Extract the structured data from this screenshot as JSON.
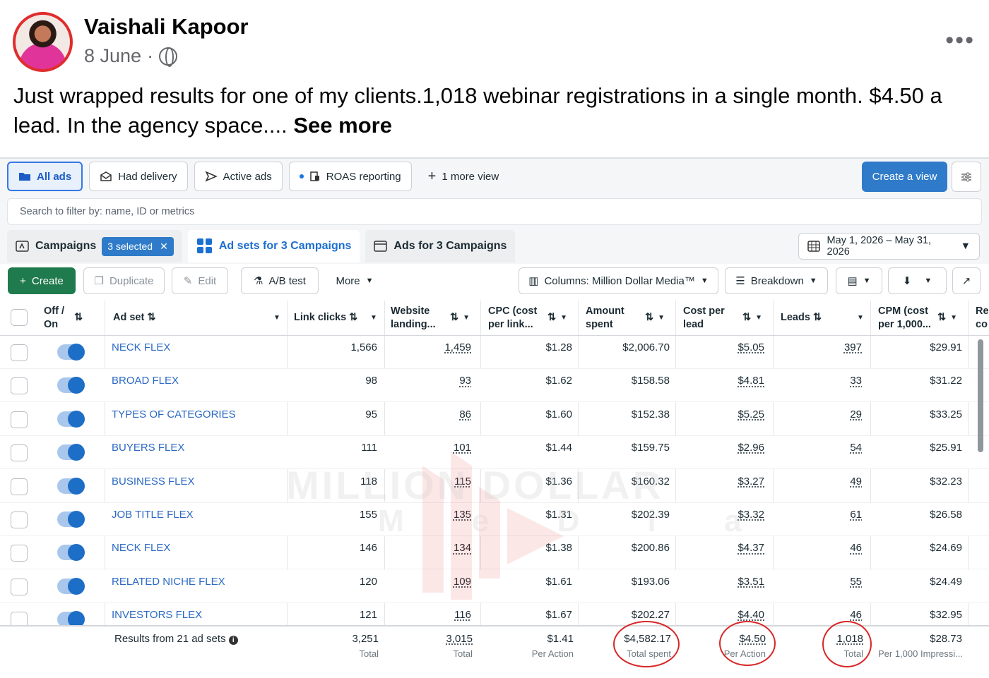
{
  "post": {
    "author": "Vaishali Kapoor",
    "date": "8 June",
    "separator": "·",
    "privacy_icon": "globe-icon",
    "text": "Just wrapped results for one of my clients.1,018 webinar registrations in a single month. $4.50 a lead. In the agency space.... ",
    "see_more": "See more",
    "more_icon": "•••"
  },
  "views": {
    "all_ads": "All ads",
    "had_delivery": "Had delivery",
    "active_ads": "Active ads",
    "roas": "ROAS reporting",
    "more_view": "1 more view",
    "create_view": "Create a view"
  },
  "search": {
    "placeholder": "Search to filter by: name, ID or metrics"
  },
  "levels": {
    "campaigns": "Campaigns",
    "selected_badge": "3 selected",
    "ad_sets": "Ad sets for 3 Campaigns",
    "ads": "Ads for 3 Campaigns"
  },
  "date_range": "May 1, 2026 – May 31, 2026",
  "toolbar": {
    "create": "Create",
    "duplicate": "Duplicate",
    "edit": "Edit",
    "ab_test": "A/B test",
    "more": "More",
    "columns": "Columns: Million Dollar Media™",
    "breakdown": "Breakdown"
  },
  "columns": {
    "offon": [
      "Off /",
      "On"
    ],
    "adset": "Ad set",
    "link_clicks": "Link clicks",
    "website": [
      "Website",
      "landing..."
    ],
    "cpc": [
      "CPC (cost",
      "per link..."
    ],
    "amount": [
      "Amount",
      "spent"
    ],
    "cost_lead": [
      "Cost per",
      "lead"
    ],
    "leads": "Leads",
    "cpm": [
      "CPM (cost",
      "per 1,000..."
    ],
    "cut": [
      "Re",
      "co"
    ]
  },
  "rows": [
    {
      "name": "NECK FLEX",
      "clicks": "1,566",
      "landing": "1,459",
      "cpc": "$1.28",
      "spent": "$2,006.70",
      "cpl": "$5.05",
      "leads": "397",
      "cpm": "$29.91"
    },
    {
      "name": "BROAD FLEX",
      "clicks": "98",
      "landing": "93",
      "cpc": "$1.62",
      "spent": "$158.58",
      "cpl": "$4.81",
      "leads": "33",
      "cpm": "$31.22"
    },
    {
      "name": "TYPES OF CATEGORIES",
      "clicks": "95",
      "landing": "86",
      "cpc": "$1.60",
      "spent": "$152.38",
      "cpl": "$5.25",
      "leads": "29",
      "cpm": "$33.25"
    },
    {
      "name": "BUYERS FLEX",
      "clicks": "111",
      "landing": "101",
      "cpc": "$1.44",
      "spent": "$159.75",
      "cpl": "$2.96",
      "leads": "54",
      "cpm": "$25.91"
    },
    {
      "name": "BUSINESS FLEX",
      "clicks": "118",
      "landing": "115",
      "cpc": "$1.36",
      "spent": "$160.32",
      "cpl": "$3.27",
      "leads": "49",
      "cpm": "$32.23"
    },
    {
      "name": "JOB TITLE FLEX",
      "clicks": "155",
      "landing": "135",
      "cpc": "$1.31",
      "spent": "$202.39",
      "cpl": "$3.32",
      "leads": "61",
      "cpm": "$26.58"
    },
    {
      "name": "NECK FLEX",
      "clicks": "146",
      "landing": "134",
      "cpc": "$1.38",
      "spent": "$200.86",
      "cpl": "$4.37",
      "leads": "46",
      "cpm": "$24.69"
    },
    {
      "name": "RELATED NICHE FLEX",
      "clicks": "120",
      "landing": "109",
      "cpc": "$1.61",
      "spent": "$193.06",
      "cpl": "$3.51",
      "leads": "55",
      "cpm": "$24.49"
    },
    {
      "name": "INVESTORS FLEX",
      "clicks": "121",
      "landing": "116",
      "cpc": "$1.67",
      "spent": "$202.27",
      "cpl": "$4.40",
      "leads": "46",
      "cpm": "$32.95"
    }
  ],
  "footer": {
    "label": "Results from 21 ad sets",
    "clicks": "3,251",
    "clicks_sub": "Total",
    "landing": "3,015",
    "landing_sub": "Total",
    "cpc": "$1.41",
    "cpc_sub": "Per Action",
    "spent": "$4,582.17",
    "spent_sub": "Total spent",
    "cpl": "$4.50",
    "cpl_sub": "Per Action",
    "leads": "1,018",
    "leads_sub": "Total",
    "cpm": "$28.73",
    "cpm_sub": "Per 1,000 Impressi..."
  },
  "watermark": {
    "line1": "MILLION DOLLAR",
    "line2": "M e D i a"
  },
  "colors": {
    "accent": "#2f7bc9",
    "create": "#1f7a4d",
    "annotation": "#d92626",
    "link": "#2b69c4"
  }
}
